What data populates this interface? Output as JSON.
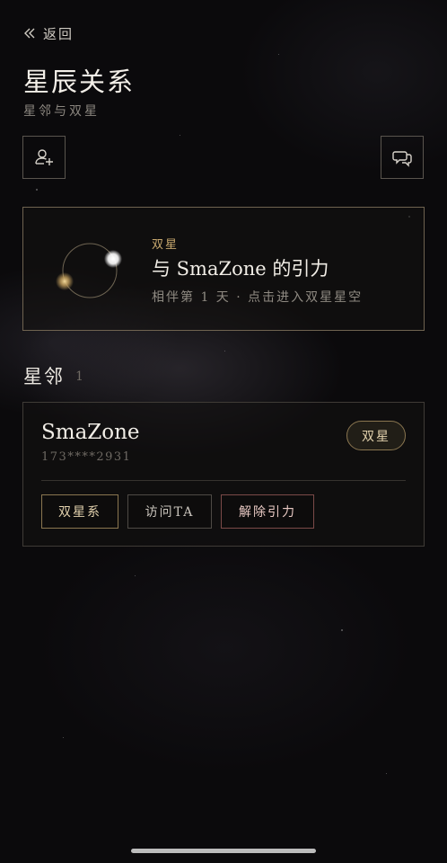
{
  "nav": {
    "back_label": "返回"
  },
  "header": {
    "title": "星辰关系",
    "subtitle": "星邻与双星"
  },
  "actions": {
    "add_contact_icon": "add-user-icon",
    "messages_icon": "chat-bubbles-icon"
  },
  "binary_card": {
    "label": "双星",
    "title": "与 SmaZone 的引力",
    "description": "相伴第 1 天 · 点击进入双星星空"
  },
  "neighbors": {
    "section_title": "星邻",
    "count": "1",
    "items": [
      {
        "name": "SmaZone",
        "phone": "173****2931",
        "badge": "双星",
        "buttons": {
          "binary_system": "双星系",
          "visit": "访问TA",
          "remove": "解除引力"
        }
      }
    ]
  },
  "colors": {
    "background": "#0b0a0c",
    "gold_accent": "#c7a86e",
    "remove_accent": "#7b4a48"
  }
}
